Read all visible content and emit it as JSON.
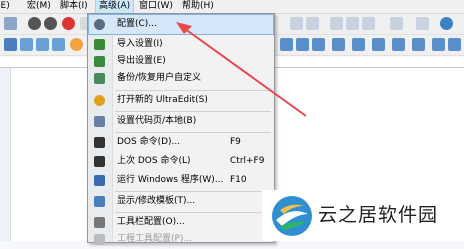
{
  "menubar": {
    "items": [
      {
        "label": "(E)"
      },
      {
        "label": "宏(M)"
      },
      {
        "label": "脚本(I)"
      },
      {
        "label": "高级(A)"
      },
      {
        "label": "窗口(W)"
      },
      {
        "label": "帮助(H)"
      }
    ]
  },
  "menu": {
    "items": [
      {
        "label": "配置(C)...",
        "shortcut": "",
        "icon": "gear-icon",
        "color": "#5a6b86"
      },
      {
        "label": "导入设置(I)",
        "shortcut": "",
        "icon": "import-icon",
        "color": "#3a8a3a"
      },
      {
        "label": "导出设置(E)",
        "shortcut": "",
        "icon": "export-icon",
        "color": "#3a8a3a"
      },
      {
        "label": "备份/恢复用户自定义",
        "shortcut": "",
        "icon": "backup-icon",
        "color": "#4a8a5a"
      },
      {
        "label": "打开新的 UltraEdit(S)",
        "shortcut": "",
        "icon": "ultraedit-icon",
        "color": "#e0a020"
      },
      {
        "label": "设置代码页/本地(B)",
        "shortcut": "",
        "icon": "codepage-icon",
        "color": "#6a7fa6"
      },
      {
        "label": "DOS 命令(D)...",
        "shortcut": "F9",
        "icon": "dos-icon",
        "color": "#333333"
      },
      {
        "label": "上次 DOS 命令(L)",
        "shortcut": "Ctrl+F9",
        "icon": "dos-last-icon",
        "color": "#333333"
      },
      {
        "label": "运行 Windows 程序(W)...",
        "shortcut": "F10",
        "icon": "windows-run-icon",
        "color": "#3a6ab0"
      },
      {
        "label": "显示/修改模板(T)...",
        "shortcut": "",
        "icon": "template-icon",
        "color": "#4a7fb8"
      },
      {
        "label": "工具栏配置(O)...",
        "shortcut": "",
        "icon": "toolbar-config-icon",
        "color": "#777777"
      },
      {
        "label": "工程工具配置(P)...",
        "shortcut": "",
        "icon": "project-tool-icon",
        "color": "#aaaaaa"
      }
    ]
  },
  "watermark": {
    "text": "云之居软件园"
  },
  "colors": {
    "highlight": "#d5e7f8",
    "arrow": "#e8474b",
    "menu_active": "#cce8ff"
  }
}
